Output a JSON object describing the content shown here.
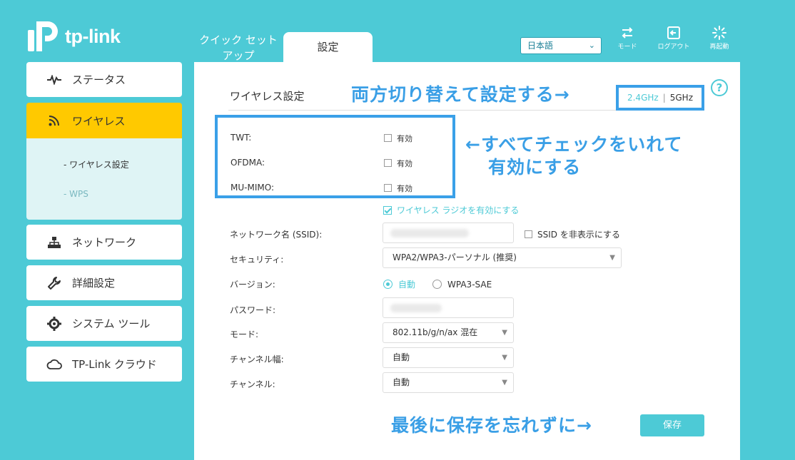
{
  "brand": {
    "name": "tp-link",
    "accent": "#4dcad6",
    "highlight": "#ffc900",
    "annotation_color": "#3a9fe6"
  },
  "header": {
    "tabs": [
      {
        "label": "クイック セット アップ",
        "active": false
      },
      {
        "label": "設定",
        "active": true
      }
    ],
    "language": "日本語",
    "icons": [
      {
        "name": "mode-icon",
        "label": "モード"
      },
      {
        "name": "logout-icon",
        "label": "ログアウト"
      },
      {
        "name": "reboot-icon",
        "label": "再起動"
      }
    ]
  },
  "sidebar": {
    "items": [
      {
        "label": "ステータス",
        "icon": "pulse-icon"
      },
      {
        "label": "ワイヤレス",
        "icon": "wifi-icon",
        "active": true
      },
      {
        "label": "ネットワーク",
        "icon": "network-icon"
      },
      {
        "label": "詳細設定",
        "icon": "wrench-icon"
      },
      {
        "label": "システム ツール",
        "icon": "gear-icon"
      },
      {
        "label": "TP-Link クラウド",
        "icon": "cloud-icon"
      }
    ],
    "subitems": [
      {
        "label": "- ワイヤレス設定",
        "active": true
      },
      {
        "label": "- WPS",
        "active": false
      }
    ]
  },
  "main": {
    "title": "ワイヤレス設定",
    "band": {
      "b24": "2.4GHz",
      "sep": "|",
      "b5": "5GHz"
    },
    "help": "?",
    "features": [
      {
        "label": "TWT:",
        "checkbox_label": "有効",
        "checked": false
      },
      {
        "label": "OFDMA:",
        "checkbox_label": "有効",
        "checked": false
      },
      {
        "label": "MU-MIMO:",
        "checkbox_label": "有効",
        "checked": false
      }
    ],
    "enable_radio": "ワイヤレス ラジオを有効にする",
    "ssid_label": "ネットワーク名 (SSID):",
    "hide_ssid": "SSID を非表示にする",
    "security_label": "セキュリティ:",
    "security_value": "WPA2/WPA3-パーソナル (推奨)",
    "version_label": "バージョン:",
    "version_auto": "自動",
    "version_sae": "WPA3-SAE",
    "password_label": "パスワード:",
    "mode_label": "モード:",
    "mode_value": "802.11b/g/n/ax 混在",
    "width_label": "チャンネル幅:",
    "width_value": "自動",
    "channel_label": "チャンネル:",
    "channel_value": "自動",
    "save": "保存"
  },
  "annotations": {
    "band": "両方切り替えて設定する→",
    "features_1": "←すべてチェックをいれて",
    "features_2": "有効にする",
    "save": "最後に保存を忘れずに→"
  }
}
